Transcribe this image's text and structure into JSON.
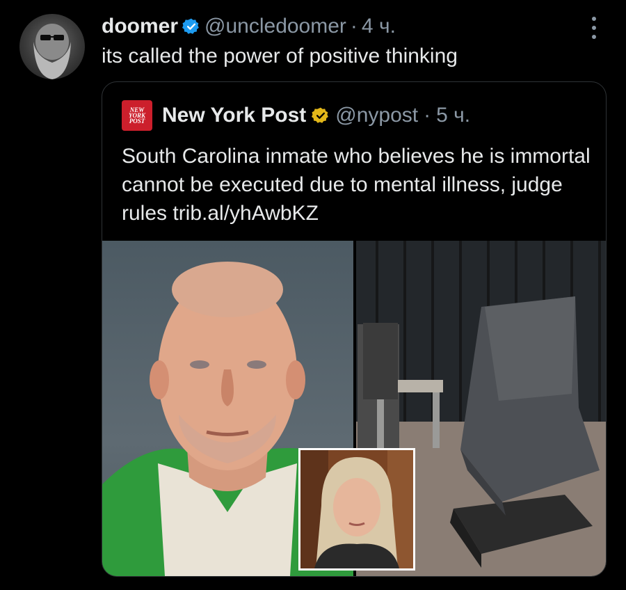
{
  "tweet": {
    "author_name": "doomer",
    "author_handle": "@uncledoomer",
    "separator": "·",
    "time": "4 ч.",
    "text": "its called the power of positive thinking"
  },
  "quote": {
    "logo_text": [
      "NEW",
      "YORK",
      "POST"
    ],
    "author_name": "New York Post",
    "author_handle": "@nypost",
    "separator": "·",
    "time": "5 ч.",
    "text": "South Carolina inmate who believes he is immortal cannot be executed due to mental illness, judge rules ",
    "link": "trib.al/yhAwbKZ"
  },
  "colors": {
    "background": "#000000",
    "text": "#e7e9ea",
    "secondary": "#8b98a5",
    "verified_blue": "#1d9bf0",
    "verified_gold": "#e2b719",
    "nyp_red": "#cc1f2c"
  }
}
